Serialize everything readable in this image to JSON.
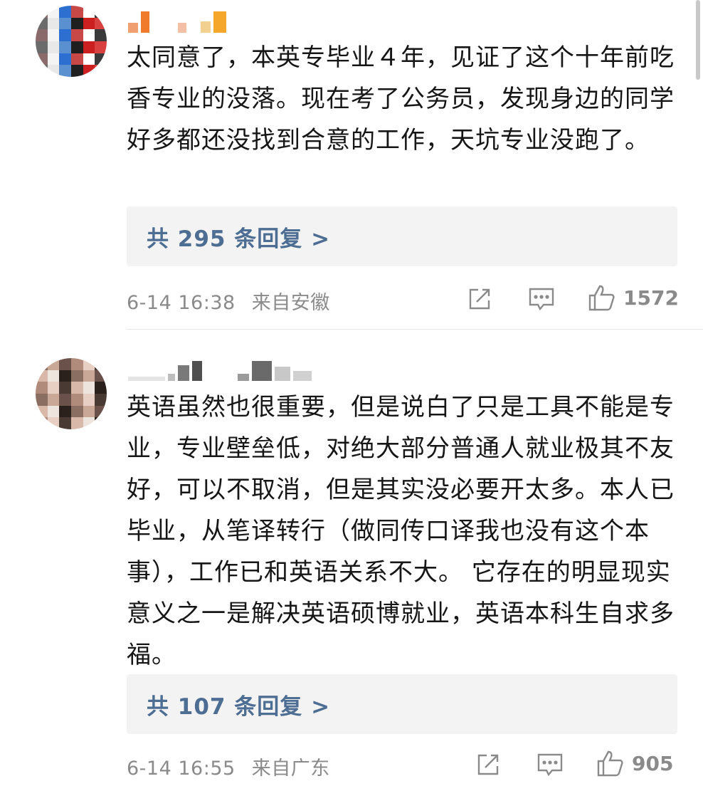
{
  "comments": [
    {
      "text": "太同意了，本英专毕业４年，见证了这个十年前吃香专业的没落。现在考了公务员，发现身边的同学好多都还没找到合意的工作，天坑专业没跑了。",
      "reply_link": "共 295 条回复 >",
      "timestamp": "6-14 16:38",
      "location": "来自安徽",
      "likes": "1572"
    },
    {
      "text": "英语虽然也很重要，但是说白了只是工具不能是专业，专业壁垒低，对绝大部分普通人就业极其不友好，可以不取消，但是其实没必要开太多。本人已毕业，从笔译转行（做同传口译我也没有这个本事），工作已和英语关系不大。 它存在的明显现实意义之一是解决英语硕博就业，英语本科生自求多福。",
      "reply_link": "共 107 条回复 >",
      "timestamp": "6-14 16:55",
      "location": "来自广东",
      "likes": "905"
    }
  ],
  "colors": {
    "reply_link": "#4d6d93",
    "meta": "#8a8a8a",
    "reply_bg": "#f3f3f3"
  },
  "icons": [
    "repost-icon",
    "comment-icon",
    "like-icon"
  ]
}
